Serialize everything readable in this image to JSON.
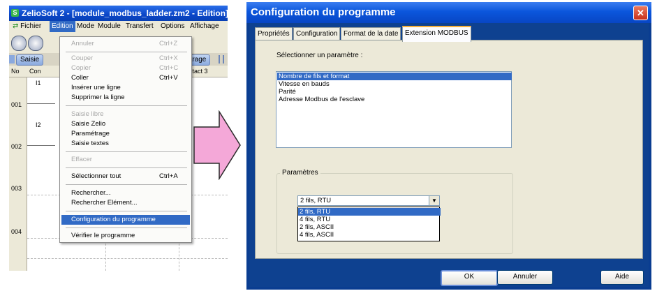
{
  "left_window": {
    "title": "ZelioSoft 2 - [module_modbus_ladder.zm2 - Edition]",
    "menubar": [
      "Fichier",
      "Edition",
      "Mode",
      "Module",
      "Transfert",
      "Options",
      "Affichage"
    ],
    "tabs": {
      "saisie": "Saisie",
      "parametrage": "étrage"
    },
    "grid": {
      "col_no": "No",
      "col_contact": "Con",
      "col_contact3": "Contact 3",
      "rows": [
        {
          "no": "001",
          "input": "I1"
        },
        {
          "no": "002",
          "input": "I2"
        },
        {
          "no": "003",
          "input": ""
        },
        {
          "no": "004",
          "input": ""
        }
      ]
    },
    "edition_menu": {
      "annuler": {
        "label": "Annuler",
        "shortcut": "Ctrl+Z"
      },
      "couper": {
        "label": "Couper",
        "shortcut": "Ctrl+X"
      },
      "copier": {
        "label": "Copier",
        "shortcut": "Ctrl+C"
      },
      "coller": {
        "label": "Coller",
        "shortcut": "Ctrl+V"
      },
      "inserer_ligne": {
        "label": "Insérer une ligne"
      },
      "supprimer_ligne": {
        "label": "Supprimer la ligne"
      },
      "saisie_libre": {
        "label": "Saisie libre"
      },
      "saisie_zelio": {
        "label": "Saisie Zelio"
      },
      "parametrage": {
        "label": "Paramétrage"
      },
      "saisie_textes": {
        "label": "Saisie textes"
      },
      "effacer": {
        "label": "Effacer"
      },
      "selectionner_tout": {
        "label": "Sélectionner tout",
        "shortcut": "Ctrl+A"
      },
      "rechercher": {
        "label": "Rechercher..."
      },
      "rechercher_element": {
        "label": "Rechercher Elément..."
      },
      "configuration_programme": {
        "label": "Configuration du programme"
      },
      "verifier_programme": {
        "label": "Vérifier le programme"
      }
    }
  },
  "dialog": {
    "title": "Configuration du programme",
    "close_glyph": "✕",
    "tabs": [
      "Propriétés",
      "Configuration",
      "Format de la date",
      "Extension MODBUS"
    ],
    "select_label": "Sélectionner un paramètre :",
    "parameters": [
      "Nombre de fils et format",
      "Vitesse en bauds",
      "Parité",
      "Adresse Modbus de l'esclave"
    ],
    "group_title": "Paramètres",
    "combo_value": "2 fils, RTU",
    "combo_options": [
      "2 fils, RTU",
      "4 fils, RTU",
      "2 fils, ASCII",
      "4 fils, ASCII"
    ],
    "buttons": {
      "ok": "OK",
      "cancel": "Annuler",
      "help": "Aide"
    }
  },
  "colors": {
    "xp_blue": "#0a46c8",
    "selection": "#316ac5",
    "arrow_fill": "#f4a8d8",
    "arrow_stroke": "#2a2a2a"
  }
}
